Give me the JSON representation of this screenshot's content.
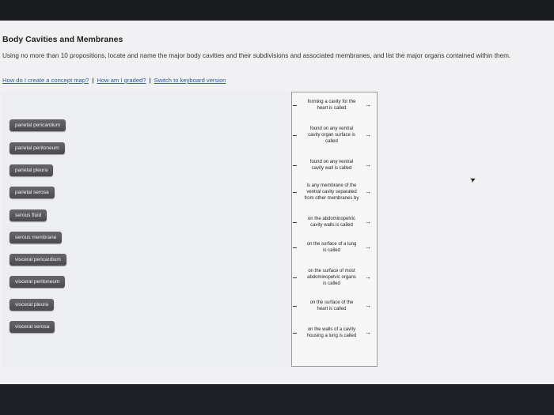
{
  "page": {
    "title": "Body Cavities and Membranes",
    "description": "Using no more than 10 propositions, locate and name the major body cavities and their subdivisions and associated membranes, and list the major organs contained within them.",
    "links": [
      {
        "label": "How do I create a concept map?"
      },
      {
        "label": "How am I graded?"
      },
      {
        "label": "Switch to keyboard version"
      }
    ]
  },
  "terms": [
    "parietal pericardium",
    "parietal peritoneum",
    "parietal pleura",
    "parietal serosa",
    "serous fluid",
    "serous membrane",
    "visceral pericardium",
    "visceral peritoneum",
    "visceral pleura",
    "visceral serosa"
  ],
  "propositions": [
    {
      "lines": [
        "forming a cavity for the",
        "heart is called"
      ]
    },
    {
      "lines": [
        "found on any ventral",
        "cavity organ surface is",
        "called"
      ]
    },
    {
      "lines": [
        "found on any ventral",
        "cavity wall is called"
      ]
    },
    {
      "lines": [
        "is any membrane of the",
        "ventral cavity separated",
        "from other membranes by"
      ]
    },
    {
      "lines": [
        "on the abdominopelvic",
        "cavity walls is called"
      ]
    },
    {
      "lines": [
        "on the surface of a lung",
        "is called"
      ]
    },
    {
      "lines": [
        "on the surface of most",
        "abdominopelvic organs",
        "is called"
      ]
    },
    {
      "lines": [
        "on the surface of the",
        "heart is called"
      ]
    },
    {
      "lines": [
        "on the walls of a cavity",
        "housing a lung is called"
      ]
    }
  ],
  "icons": {
    "dash": "dash-icon",
    "arrow": "arrow-right-icon",
    "arrow_glyph": "→",
    "separator": "|",
    "cursor_glyph": "➤"
  }
}
